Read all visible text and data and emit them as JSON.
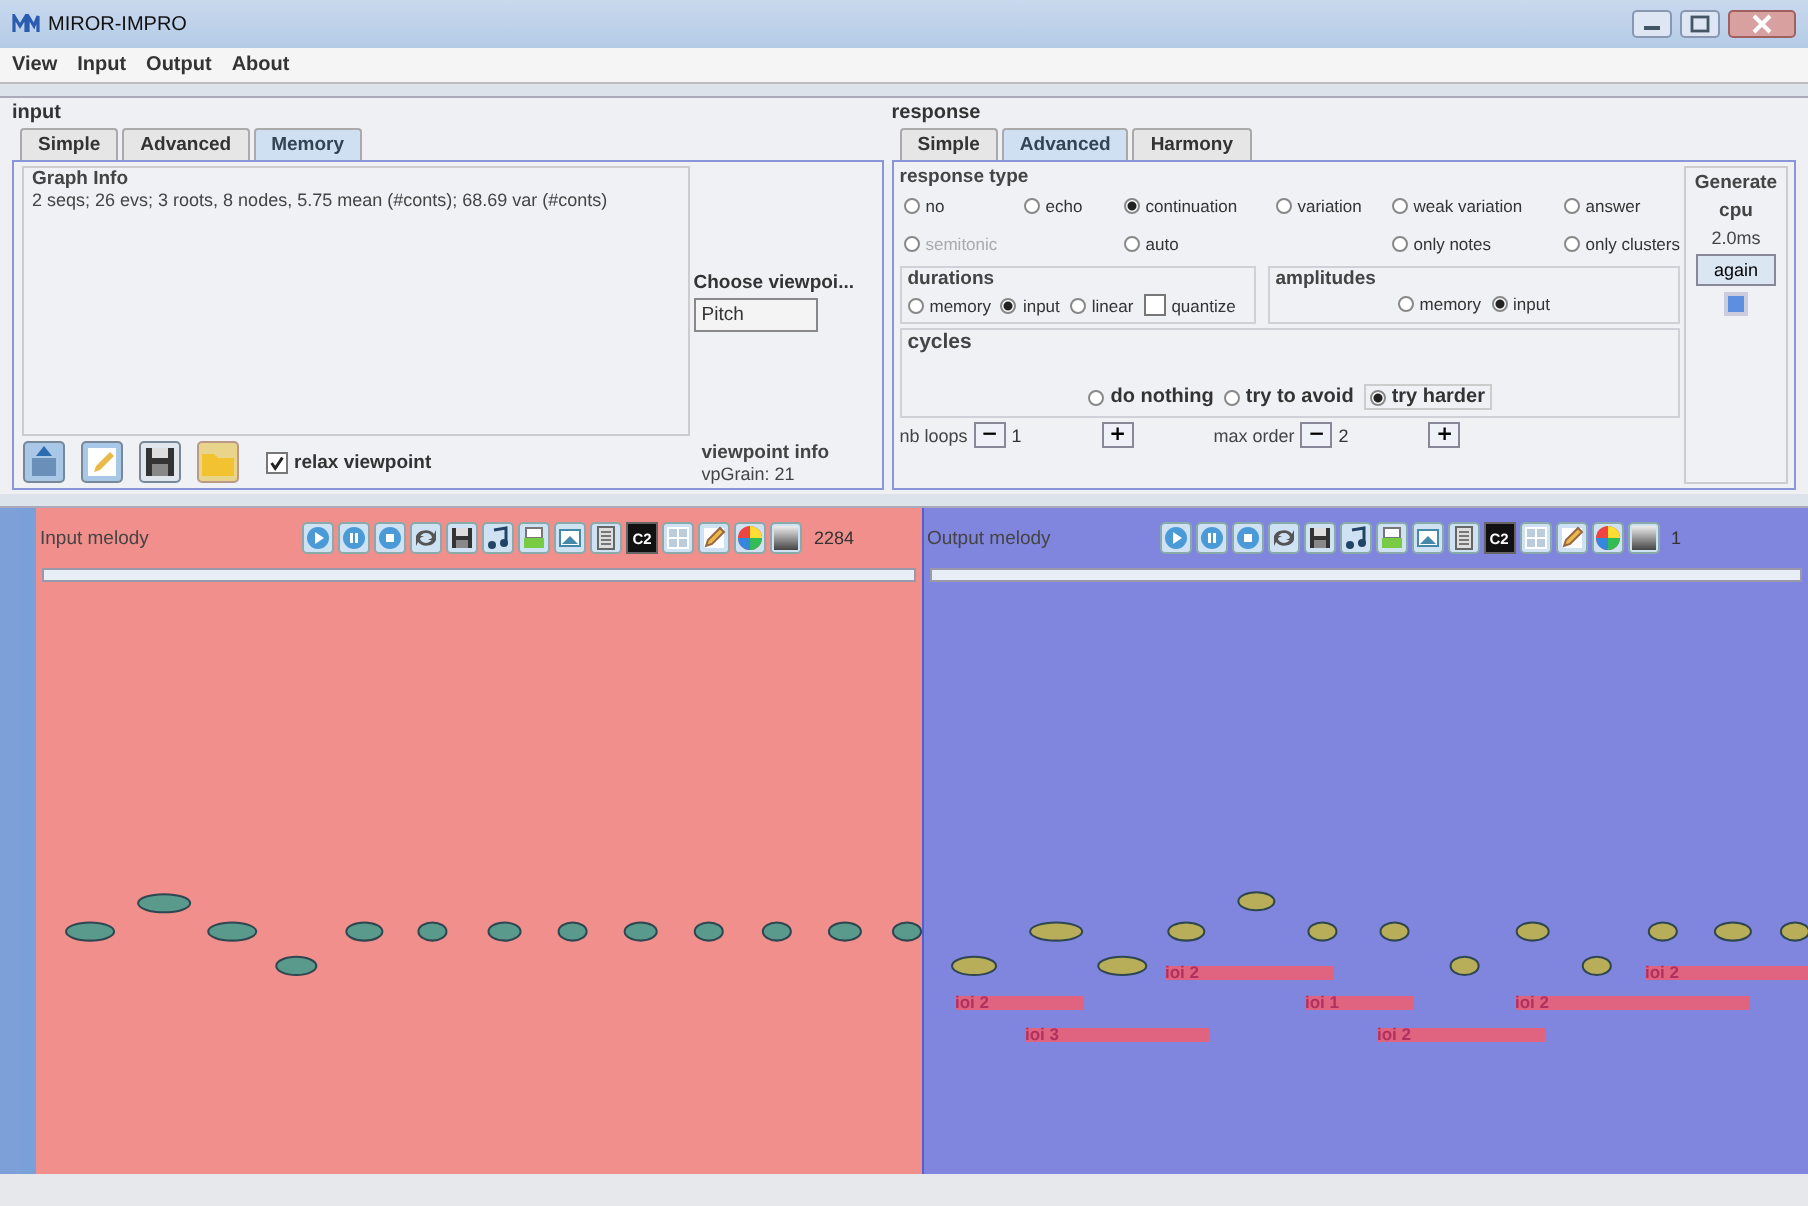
{
  "window": {
    "title": "MIROR-IMPRO"
  },
  "menu": [
    "View",
    "Input",
    "Output",
    "About"
  ],
  "input": {
    "title": "input",
    "tabs": [
      {
        "label": "Simple",
        "selected": false
      },
      {
        "label": "Advanced",
        "selected": false
      },
      {
        "label": "Memory",
        "selected": true
      }
    ],
    "graph_info": {
      "title": "Graph Info",
      "text": "2 seqs; 26 evs; 3 roots, 8 nodes, 5.75 mean (#conts); 68.69 var (#conts)"
    },
    "viewpoint": {
      "label": "Choose viewpoi...",
      "value": "Pitch"
    },
    "relax_viewpoint": {
      "label": "relax viewpoint",
      "checked": true
    },
    "viewpoint_info": {
      "title": "viewpoint info",
      "text": "vpGrain: 21"
    }
  },
  "response": {
    "title": "response",
    "tabs": [
      {
        "label": "Simple",
        "selected": false
      },
      {
        "label": "Advanced",
        "selected": true
      },
      {
        "label": "Harmony",
        "selected": false
      }
    ],
    "response_type": {
      "title": "response type",
      "row_1": [
        {
          "label": "no",
          "selected": false,
          "disabled": false
        },
        {
          "label": "echo",
          "selected": false,
          "disabled": false
        },
        {
          "label": "continuation",
          "selected": true,
          "disabled": false
        },
        {
          "label": "variation",
          "selected": false,
          "disabled": false
        },
        {
          "label": "weak variation",
          "selected": false,
          "disabled": false
        },
        {
          "label": "answer",
          "selected": false,
          "disabled": false
        }
      ],
      "row_2": [
        {
          "label": "semitonic",
          "selected": false,
          "disabled": true
        },
        {
          "label": "auto",
          "selected": false,
          "disabled": false
        },
        {
          "label": "only notes",
          "selected": false,
          "disabled": false
        },
        {
          "label": "only clusters",
          "selected": false,
          "disabled": false
        }
      ]
    },
    "durations": {
      "title": "durations",
      "options": [
        {
          "label": "memory",
          "selected": false
        },
        {
          "label": "input",
          "selected": true
        },
        {
          "label": "linear",
          "selected": false
        }
      ],
      "quantize": {
        "label": "quantize",
        "checked": false
      }
    },
    "amplitudes": {
      "title": "amplitudes",
      "options": [
        {
          "label": "memory",
          "selected": false
        },
        {
          "label": "input",
          "selected": true
        }
      ]
    },
    "cycles": {
      "title": "cycles",
      "options": [
        {
          "label": "do nothing",
          "selected": false
        },
        {
          "label": "try to avoid",
          "selected": false
        },
        {
          "label": "try harder",
          "selected": true
        }
      ]
    },
    "nb_loops": {
      "label": "nb loops",
      "minus": "−",
      "value": "1",
      "plus": "+"
    },
    "max_order": {
      "label": "max order",
      "minus": "−",
      "value": "2",
      "plus": "+"
    },
    "generate": {
      "title": "Generate",
      "cpu_label": "cpu",
      "cpu_value": "2.0ms",
      "again": "again",
      "toggle_on": true
    }
  },
  "input_melody": {
    "title": "Input melody",
    "c2": "C2",
    "count": "2284"
  },
  "output_melody": {
    "title": "Output melody",
    "c2": "C2",
    "count": "1",
    "labels": [
      {
        "text": "ioi 2"
      },
      {
        "text": "ioi 2"
      },
      {
        "text": "ioi 2"
      },
      {
        "text": "ioi 1"
      },
      {
        "text": "ioi 2"
      },
      {
        "text": "ioi 3"
      },
      {
        "text": "ioi 2"
      }
    ]
  }
}
